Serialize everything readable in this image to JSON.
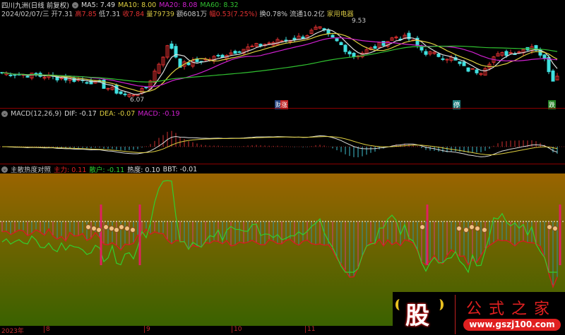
{
  "header": {
    "title": "四川九洲(日线 前复权)",
    "ma5": "MA5: 7.49",
    "ma10": "MA10: 8.00",
    "ma20": "MA20: 8.08",
    "ma60": "MA60: 8.32",
    "date": "2024/02/07/三",
    "open_l": "开",
    "open": "7.31",
    "high_l": "高",
    "high": "7.85",
    "low_l": "低",
    "low": "7.31",
    "close_l": "收",
    "close": "7.84",
    "vol_l": "量",
    "vol": "79739",
    "amt": "额6081万",
    "chg_l": "幅",
    "chg": "0.53(7.25%)",
    "turn": "换0.78%",
    "float": "流通10.2亿",
    "sector": "家用电器"
  },
  "price": {
    "max_label": "9.53",
    "min_label": "6.07"
  },
  "markers": {
    "m1a": "财",
    "m1b": "涨",
    "m2": "停",
    "m3": "跌"
  },
  "macd": {
    "title": "MACD(12,26,9)",
    "dif": "DIF: -0.17",
    "dea": "DEA: -0.07",
    "macd": "MACD: -0.19"
  },
  "ind": {
    "title": "主散热度对照",
    "main": "主力: 0.11",
    "retail": "散户: -0.11",
    "heat": "热度: 0.10",
    "bbt": "BBT: -0.01"
  },
  "axis": {
    "year": "2023年",
    "m8": "8",
    "m9": "9",
    "m10": "10",
    "m11": "11"
  },
  "logo": {
    "char": "股",
    "name": "公式之家",
    "url": "www.gszj100.com"
  },
  "chart_data": {
    "type": "candlestick",
    "price_keypoints": [
      [
        0,
        7.25
      ],
      [
        60,
        7.1
      ],
      [
        130,
        6.85
      ],
      [
        180,
        6.2
      ],
      [
        205,
        6.45
      ],
      [
        240,
        8.6
      ],
      [
        255,
        7.6
      ],
      [
        300,
        7.9
      ],
      [
        340,
        8.3
      ],
      [
        380,
        8.6
      ],
      [
        430,
        8.9
      ],
      [
        450,
        9.3
      ],
      [
        480,
        8.6
      ],
      [
        500,
        8.0
      ],
      [
        530,
        8.4
      ],
      [
        560,
        8.9
      ],
      [
        580,
        8.8
      ],
      [
        600,
        8.2
      ],
      [
        640,
        7.9
      ],
      [
        660,
        7.4
      ],
      [
        680,
        7.3
      ],
      [
        700,
        8.0
      ],
      [
        740,
        8.3
      ],
      [
        755,
        8.5
      ],
      [
        770,
        7.9
      ],
      [
        785,
        6.8
      ],
      [
        795,
        7.84
      ]
    ]
  }
}
